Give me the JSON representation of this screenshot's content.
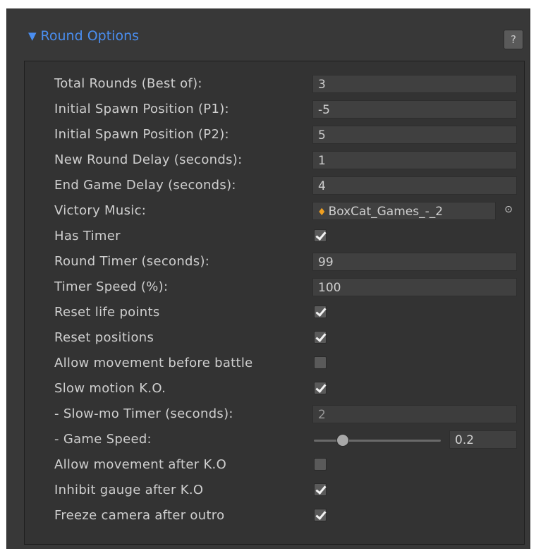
{
  "section": {
    "title": "Round Options",
    "help_label": "?"
  },
  "fields": {
    "total_rounds": {
      "label": "Total Rounds (Best of):",
      "value": "3"
    },
    "spawn_p1": {
      "label": "Initial Spawn Position (P1):",
      "value": "-5"
    },
    "spawn_p2": {
      "label": "Initial Spawn Position (P2):",
      "value": "5"
    },
    "new_round_delay": {
      "label": "New Round Delay (seconds):",
      "value": "1"
    },
    "end_game_delay": {
      "label": "End Game Delay (seconds):",
      "value": "4"
    },
    "victory_music": {
      "label": "Victory Music:",
      "value": "BoxCat_Games_-_2",
      "icon": "audio-clip-icon"
    },
    "has_timer": {
      "label": "Has Timer",
      "checked": true
    },
    "round_timer": {
      "label": "Round Timer (seconds):",
      "value": "99"
    },
    "timer_speed": {
      "label": "Timer Speed (%):",
      "value": "100"
    },
    "reset_life": {
      "label": "Reset life points",
      "checked": true
    },
    "reset_positions": {
      "label": "Reset positions",
      "checked": true
    },
    "allow_move_before": {
      "label": "Allow movement before battle",
      "checked": false
    },
    "slow_motion_ko": {
      "label": "Slow motion K.O.",
      "checked": true
    },
    "slowmo_timer": {
      "label": "- Slow-mo Timer (seconds):",
      "value": "2"
    },
    "game_speed": {
      "label": "- Game Speed:",
      "value": "0.2",
      "slider_fraction": 0.2
    },
    "allow_move_after": {
      "label": "Allow movement after K.O",
      "checked": false
    },
    "inhibit_gauge": {
      "label": "Inhibit gauge after K.O",
      "checked": true
    },
    "freeze_camera": {
      "label": "Freeze camera after outro",
      "checked": true
    }
  },
  "colors": {
    "background": "#383838",
    "panel": "#333333",
    "accent": "#4a8ef0",
    "audio_icon": "#f0a020"
  }
}
